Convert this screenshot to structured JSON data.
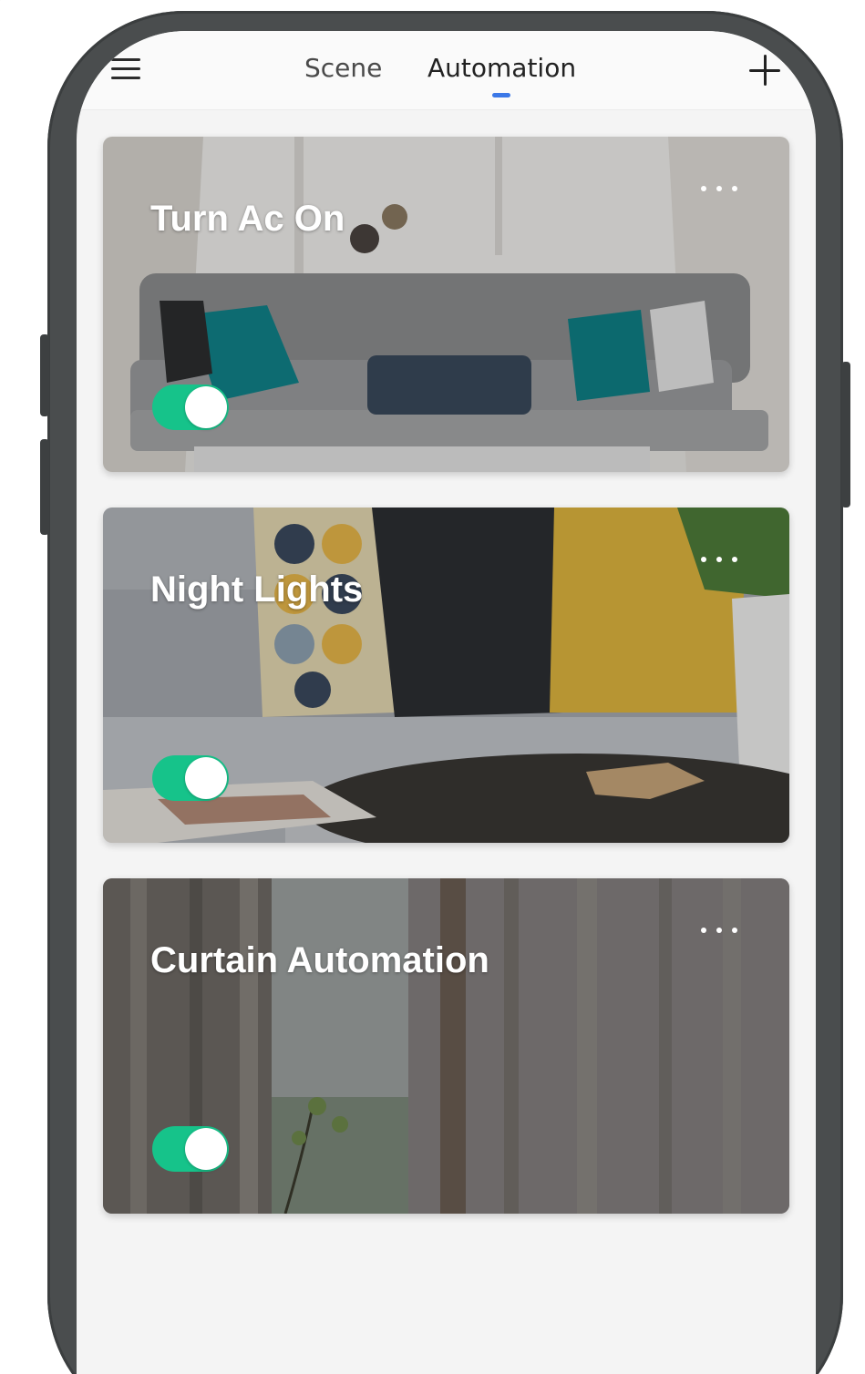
{
  "header": {
    "tabs": [
      {
        "label": "Scene",
        "active": false
      },
      {
        "label": "Automation",
        "active": true
      }
    ],
    "menu_icon": "hamburger-menu-icon",
    "add_icon": "plus-icon"
  },
  "automations": [
    {
      "title": "Turn Ac On",
      "enabled": true,
      "more_icon": "more-dots-icon"
    },
    {
      "title": "Night Lights",
      "enabled": true,
      "more_icon": "more-dots-icon"
    },
    {
      "title": "Curtain Automation",
      "enabled": true,
      "more_icon": "more-dots-icon"
    }
  ],
  "colors": {
    "accent": "#3b78e7",
    "toggle_on": "#16c38a",
    "phone_frame": "#4a4d4e"
  }
}
